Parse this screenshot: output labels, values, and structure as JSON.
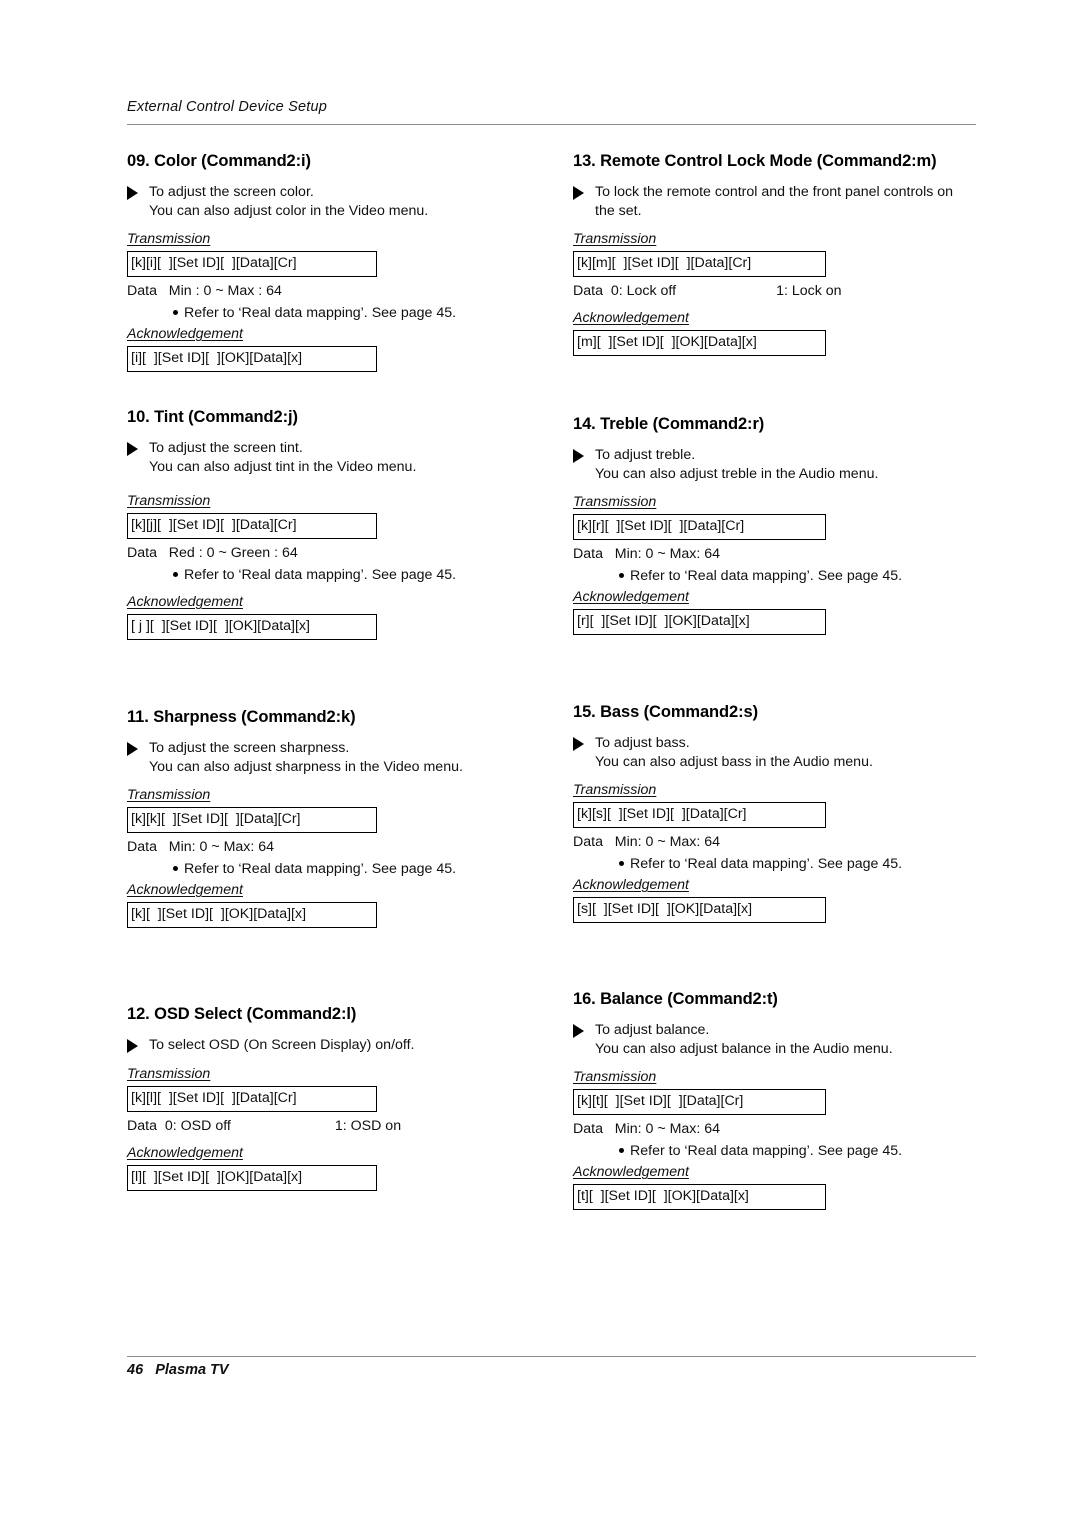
{
  "header": {
    "running_head": "External Control Device Setup"
  },
  "footer": {
    "page_number": "46",
    "product": "Plasma TV"
  },
  "labels": {
    "transmission": "Transmission",
    "acknowledgement": "Acknowledgement"
  },
  "sections": [
    {
      "id": "color",
      "title": "09. Color (Command2:i)",
      "desc_line1": "To adjust the screen color.",
      "desc_line2": "You can also adjust color in the Video menu.",
      "transmission": "[k][i][  ][Set ID][  ][Data][Cr]",
      "data_label": "Data",
      "data_value": "Min : 0 ~ Max : 64",
      "data_value2": "",
      "note": "Refer to ‘Real data mapping’. See page 45.",
      "acknowledgement": "[i][  ][Set ID][  ][OK][Data][x]"
    },
    {
      "id": "tint",
      "title": "10. Tint (Command2:j)",
      "desc_line1": "To adjust the screen tint.",
      "desc_line2": "You can also adjust tint in the Video menu.",
      "transmission": "[k][j][  ][Set ID][  ][Data][Cr]",
      "data_label": "Data",
      "data_value": "Red : 0 ~ Green : 64",
      "data_value2": "",
      "note": "Refer to ‘Real data mapping’. See page 45.",
      "acknowledgement": "[ j ][  ][Set ID][  ][OK][Data][x]"
    },
    {
      "id": "sharpness",
      "title": "11. Sharpness (Command2:k)",
      "desc_line1": "To adjust the screen sharpness.",
      "desc_line2": "You can also adjust sharpness in the Video menu.",
      "transmission": "[k][k][  ][Set ID][  ][Data][Cr]",
      "data_label": "Data",
      "data_value": "Min: 0 ~ Max: 64",
      "data_value2": "",
      "note": "Refer to ‘Real data mapping’. See page 45.",
      "acknowledgement": "[k][  ][Set ID][  ][OK][Data][x]"
    },
    {
      "id": "osd-select",
      "title": "12. OSD Select (Command2:l)",
      "desc_line1": "To select OSD (On Screen Display) on/off.",
      "desc_line2": "",
      "transmission": "[k][l][  ][Set ID][  ][Data][Cr]",
      "data_label": "Data",
      "data_value": "0: OSD off",
      "data_value2": "1: OSD on",
      "note": "",
      "acknowledgement": "[l][  ][Set ID][  ][OK][Data][x]"
    },
    {
      "id": "remote-control-lock-mode",
      "title": "13. Remote Control Lock Mode (Command2:m)",
      "desc_line1": "To lock the remote control and the front panel controls on",
      "desc_line2": "the set.",
      "transmission": "[k][m][  ][Set ID][  ][Data][Cr]",
      "data_label": "Data",
      "data_value": "0: Lock off",
      "data_value2": "1: Lock on",
      "note": "",
      "acknowledgement": "[m][  ][Set ID][  ][OK][Data][x]"
    },
    {
      "id": "treble",
      "title": "14. Treble (Command2:r)",
      "desc_line1": "To adjust treble.",
      "desc_line2": "You can also adjust treble in the Audio menu.",
      "transmission": "[k][r][  ][Set ID][  ][Data][Cr]",
      "data_label": "Data",
      "data_value": "Min: 0 ~ Max: 64",
      "data_value2": "",
      "note": "Refer to ‘Real data mapping’. See page 45.",
      "acknowledgement": "[r][  ][Set ID][  ][OK][Data][x]"
    },
    {
      "id": "bass",
      "title": "15. Bass (Command2:s)",
      "desc_line1": "To adjust bass.",
      "desc_line2": "You can also adjust bass in the Audio menu.",
      "transmission": "[k][s][  ][Set ID][  ][Data][Cr]",
      "data_label": "Data",
      "data_value": "Min: 0 ~ Max: 64",
      "data_value2": "",
      "note": "Refer to ‘Real data mapping’. See page 45.",
      "acknowledgement": "[s][  ][Set ID][  ][OK][Data][x]"
    },
    {
      "id": "balance",
      "title": "16. Balance (Command2:t)",
      "desc_line1": "To adjust balance.",
      "desc_line2": "You can also adjust balance in the Audio menu.",
      "transmission": "[k][t][  ][Set ID][  ][Data][Cr]",
      "data_label": "Data",
      "data_value": "Min: 0 ~ Max: 64",
      "data_value2": "",
      "note": "Refer to ‘Real data mapping’. See page 45.",
      "acknowledgement": "[t][  ][Set ID][  ][OK][Data][x]"
    }
  ]
}
